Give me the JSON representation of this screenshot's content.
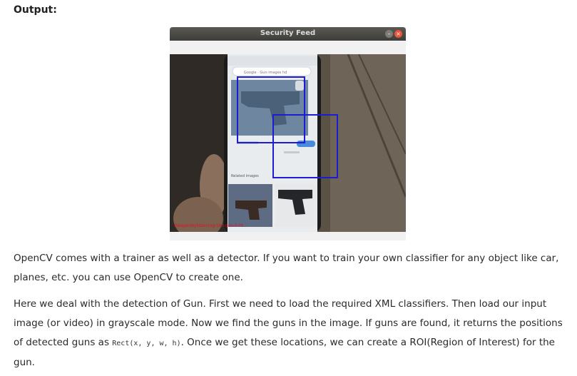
{
  "heading": "Output:",
  "window": {
    "title": "Security Feed",
    "minimize_glyph": "–",
    "close_glyph": "×",
    "minimize_icon": "minimize-icon",
    "close_icon": "close-icon"
  },
  "feed": {
    "search_bar_text": "Google · Gun images hd",
    "related_label": "Related images",
    "overlay_text": "Weaponbylistening-Ukr-gun-0-ht..."
  },
  "colors": {
    "detection_box": "#1c1cd2",
    "title_bar": "#4a4945",
    "close_button": "#e8553b"
  },
  "paragraph1": "OpenCV comes with a trainer as well as a detector. If you want to train your own classifier for any object like car, planes, etc. you can use OpenCV to create one.",
  "paragraph2": {
    "before": "Here we deal with the detection of Gun. First we need to load the required XML classifiers. Then load our input image (or video) in grayscale mode. Now we find the guns in the image. If guns are found, it returns the positions of detected guns as ",
    "code": "Rect(x, y, w, h)",
    "after": ". Once we get these locations, we can create a ROI(Region of Interest) for the gun."
  }
}
